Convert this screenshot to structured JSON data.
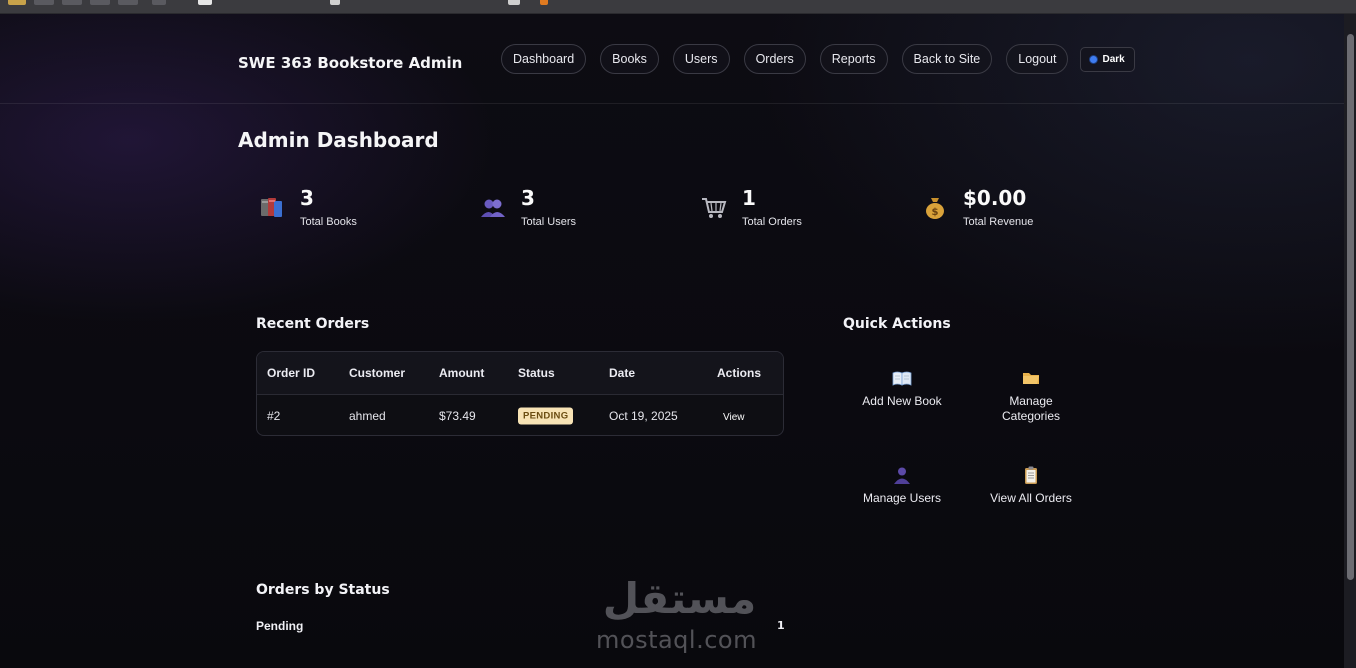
{
  "header": {
    "brand": "SWE 363 Bookstore Admin",
    "nav": [
      "Dashboard",
      "Books",
      "Users",
      "Orders",
      "Reports",
      "Back to Site",
      "Logout"
    ],
    "theme_label": "Dark"
  },
  "page": {
    "title": "Admin Dashboard"
  },
  "stats": [
    {
      "icon": "books-icon",
      "value": "3",
      "label": "Total Books"
    },
    {
      "icon": "users-icon",
      "value": "3",
      "label": "Total Users"
    },
    {
      "icon": "cart-icon",
      "value": "1",
      "label": "Total Orders"
    },
    {
      "icon": "money-bag-icon",
      "value": "$0.00",
      "label": "Total Revenue"
    }
  ],
  "recent_orders": {
    "title": "Recent Orders",
    "columns": [
      "Order ID",
      "Customer",
      "Amount",
      "Status",
      "Date",
      "Actions"
    ],
    "rows": [
      {
        "id": "#2",
        "customer": "ahmed",
        "amount": "$73.49",
        "status": "PENDING",
        "date": "Oct 19, 2025",
        "action": "View"
      }
    ]
  },
  "quick_actions": {
    "title": "Quick Actions",
    "items": [
      {
        "icon": "open-book-icon",
        "label": "Add New Book"
      },
      {
        "icon": "folder-icon",
        "label": "Manage Categories"
      },
      {
        "icon": "user-icon",
        "label": "Manage Users"
      },
      {
        "icon": "clipboard-icon",
        "label": "View All Orders"
      }
    ]
  },
  "orders_by_status": {
    "title": "Orders by Status",
    "items": [
      {
        "label": "Pending",
        "count": "1"
      }
    ]
  },
  "watermark": {
    "arabic": "مستقل",
    "latin": "mostaql.com"
  },
  "colors": {
    "background": "#0b0a10",
    "pill_border": "#3a3a44",
    "badge_bg": "#f7e3b5",
    "badge_text": "#6b4d12",
    "theme_dot": "#3f7cf0"
  }
}
